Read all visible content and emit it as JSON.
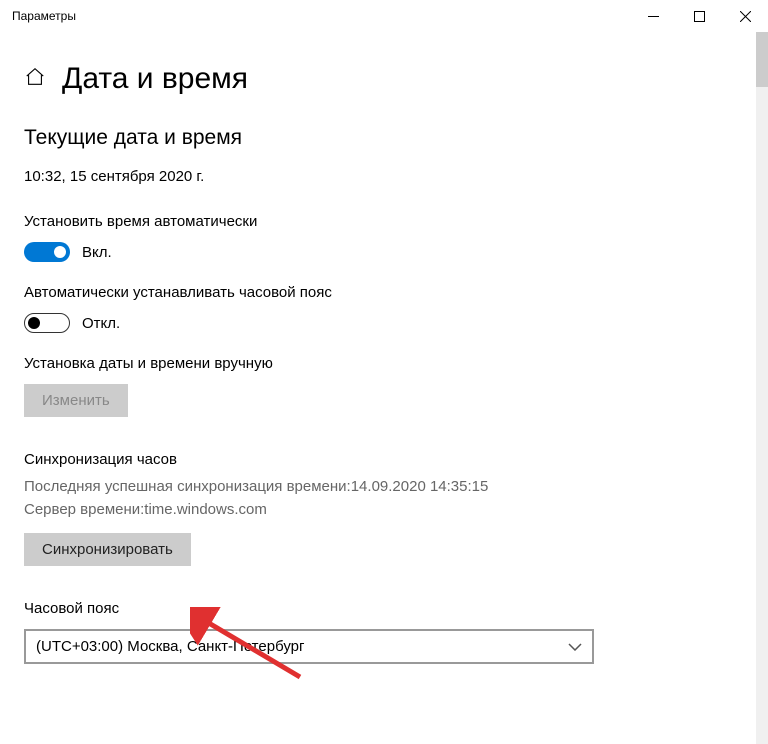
{
  "window": {
    "title": "Параметры"
  },
  "page": {
    "heading": "Дата и время",
    "current_heading": "Текущие дата и время",
    "current_datetime": "10:32, 15 сентября 2020 г."
  },
  "auto_time": {
    "label": "Установить время автоматически",
    "state": "Вкл."
  },
  "auto_tz": {
    "label": "Автоматически устанавливать часовой пояс",
    "state": "Откл."
  },
  "manual": {
    "label": "Установка даты и времени вручную",
    "button": "Изменить"
  },
  "sync": {
    "heading": "Синхронизация часов",
    "last_sync_line": "Последняя успешная синхронизация времени:14.09.2020 14:35:15",
    "server_line": "Сервер времени:time.windows.com",
    "button": "Синхронизировать"
  },
  "timezone": {
    "heading": "Часовой пояс",
    "selected": "(UTC+03:00) Москва, Санкт-Петербург"
  }
}
